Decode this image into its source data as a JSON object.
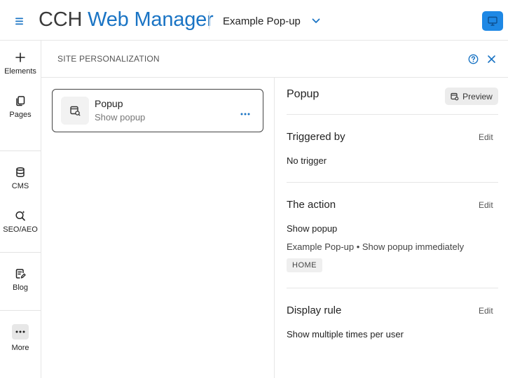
{
  "app": {
    "brand_primary": "CCH",
    "brand_secondary": "Web Manager",
    "site_selector": "Example Pop-up",
    "accent_color": "#1e88e5",
    "brand_color": "#1a74c4"
  },
  "rail": {
    "items": [
      {
        "label": "Elements",
        "icon": "plus-icon"
      },
      {
        "label": "Pages",
        "icon": "pages-icon"
      },
      {
        "label": "CMS",
        "icon": "database-icon"
      },
      {
        "label": "SEO/AEO",
        "icon": "seo-icon"
      },
      {
        "label": "Blog",
        "icon": "blog-icon"
      },
      {
        "label": "More",
        "icon": "more-icon"
      }
    ]
  },
  "panel": {
    "title": "SITE PERSONALIZATION"
  },
  "list": {
    "items": [
      {
        "title": "Popup",
        "subtitle": "Show popup",
        "icon": "popup-icon"
      }
    ]
  },
  "detail": {
    "title": "Popup",
    "preview_label": "Preview",
    "edit_label": "Edit",
    "triggered_by": {
      "title": "Triggered by",
      "value": "No trigger"
    },
    "action": {
      "title": "The action",
      "value": "Show popup",
      "description": "Example Pop-up • Show popup immediately",
      "tag": "HOME"
    },
    "display_rule": {
      "title": "Display rule",
      "value": "Show multiple times per user"
    }
  }
}
